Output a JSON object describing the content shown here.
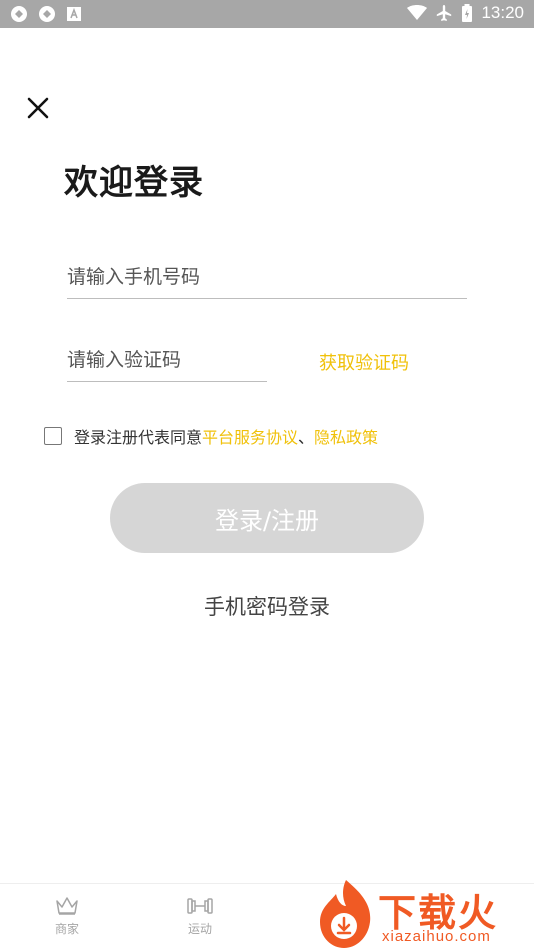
{
  "status_bar": {
    "time": "13:20"
  },
  "page": {
    "title": "欢迎登录",
    "phone_placeholder": "请输入手机号码",
    "code_placeholder": "请输入验证码",
    "get_code_label": "获取验证码",
    "agreement": {
      "prefix": "登录注册代表同意",
      "service_link": "平台服务协议",
      "separator": "、",
      "privacy_link": "隐私政策"
    },
    "login_button": "登录/注册",
    "password_login": "手机密码登录"
  },
  "tab_bar": {
    "tabs": [
      {
        "label": "商家",
        "icon": "crown-icon"
      },
      {
        "label": "运动",
        "icon": "dumbbell-icon"
      }
    ]
  },
  "watermark": {
    "brand": "下载火",
    "url": "xiazaihuo.com"
  },
  "colors": {
    "accent": "#f0c10a",
    "button_disabled": "#d6d6d6",
    "status_bar": "#a7a7a7",
    "watermark": "#f05a24"
  }
}
